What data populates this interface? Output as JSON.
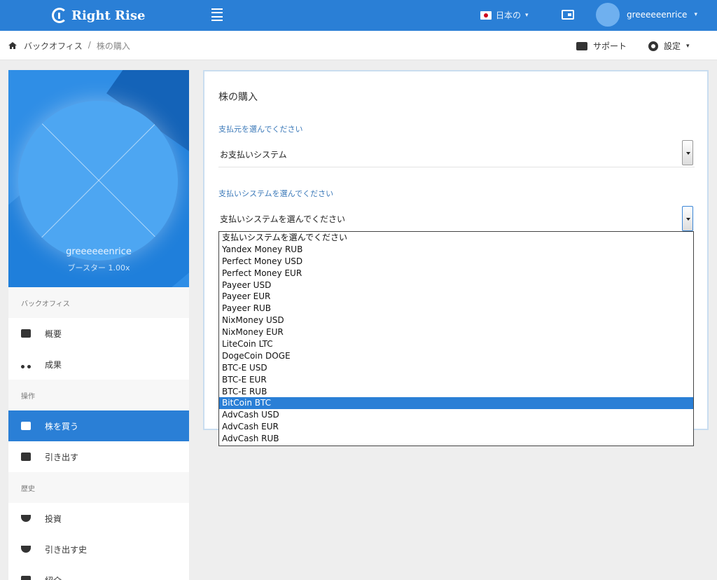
{
  "header": {
    "brand": "Right Rise",
    "language": "日本の",
    "username": "greeeeeenrice",
    "icons": [
      "menu-icon",
      "flag-jp-icon",
      "wallet-icon",
      "avatar"
    ]
  },
  "breadcrumb": {
    "home": "バックオフィス",
    "separator": "/",
    "current": "株の購入",
    "support": "サポート",
    "settings": "設定"
  },
  "sidebar": {
    "profile": {
      "name": "greeeeeenrice",
      "booster": "ブースター 1.00x"
    },
    "sections": {
      "backoffice": "バックオフィス",
      "operations": "操作",
      "history": "歴史"
    },
    "items": {
      "overview": "概要",
      "results": "成果",
      "buy_shares": "株を買う",
      "withdraw": "引き出す",
      "investment": "投資",
      "withdraw_history": "引き出す史",
      "next": "紹介"
    }
  },
  "main": {
    "title": "株の購入",
    "source_label": "支払元を選んでください",
    "source_value": "お支払いシステム",
    "system_label": "支払いシステムを選んでください",
    "system_value": "支払いシステムを選んでください",
    "options": [
      "支払いシステムを選んでください",
      "Yandex Money RUB",
      "Perfect Money USD",
      "Perfect Money EUR",
      "Payeer USD",
      "Payeer EUR",
      "Payeer RUB",
      "NixMoney USD",
      "NixMoney EUR",
      "LiteCoin LTC",
      "DogeCoin DOGE",
      "BTC-E USD",
      "BTC-E EUR",
      "BTC-E RUB",
      "BitCoin BTC",
      "AdvCash USD",
      "AdvCash EUR",
      "AdvCash RUB"
    ],
    "highlighted_option": "BitCoin BTC"
  },
  "colors": {
    "primary": "#2a7fd6",
    "label_blue": "#3a78b8",
    "background": "#eeeeee"
  }
}
